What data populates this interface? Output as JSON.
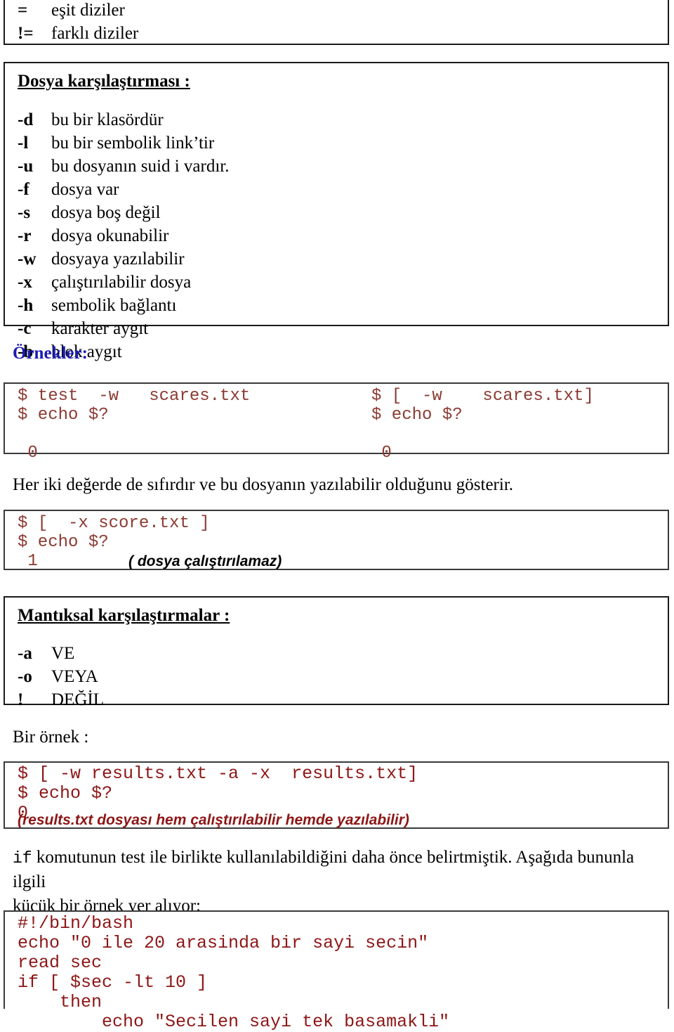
{
  "document": {
    "language": "tr",
    "accent_blue": "#1b1bb3",
    "code_color": "#8b3a32",
    "code_color_dark": "#8e1616"
  },
  "string_compare_box": {
    "rows": [
      {
        "key": "=",
        "value": "eşit diziler"
      },
      {
        "key": "!=",
        "value": "farklı diziler"
      }
    ]
  },
  "file_compare_box": {
    "title": "Dosya karşılaştırması :",
    "rows": [
      {
        "key": "-d",
        "value": "bu bir klasördür"
      },
      {
        "key": "-l",
        "value": "bu bir sembolik link’tir"
      },
      {
        "key": "-u",
        "value": "bu dosyanın suid i vardır."
      },
      {
        "key": "-f",
        "value": "dosya var"
      },
      {
        "key": "-s",
        "value": "dosya boş değil"
      },
      {
        "key": "-r",
        "value": "dosya okunabilir"
      },
      {
        "key": "-w",
        "value": "dosyaya yazılabilir"
      },
      {
        "key": "-x",
        "value": "çalıştırılabilir dosya"
      },
      {
        "key": "-h",
        "value": "sembolik bağlantı"
      },
      {
        "key": "-c",
        "value": "karakter aygıt"
      },
      {
        "key": "-b",
        "value": "blok aygıt"
      }
    ]
  },
  "examples": {
    "heading": "Örnekler:",
    "code_left": "$ test  -w   scares.txt\n$ echo $?\n\n 0",
    "code_right": "$ [  -w    scares.txt]\n$ echo $?\n\n 0",
    "explanation": "Her iki değerde de sıfırdır ve bu dosyanın yazılabilir olduğunu gösterir."
  },
  "exec_example": {
    "code": "$ [  -x score.txt ]\n$ echo $?\n 1",
    "annotation": "( dosya çalıştırılamaz)"
  },
  "logical_box": {
    "title": "Mantıksal karşılaştırmalar :",
    "rows": [
      {
        "key": "-a",
        "value": "VE"
      },
      {
        "key": "-o",
        "value": "VEYA"
      },
      {
        "key": "!",
        "value": "DEĞİL"
      }
    ]
  },
  "example_intro": "Bir örnek :",
  "and_example": {
    "code": "$ [ -w results.txt -a -x  results.txt]\n$ echo $?\n0",
    "annotation": "(results.txt dosyası hem çalıştırılabilir hemde yazılabilir)"
  },
  "if_paragraph": {
    "mono_prefix": "if",
    "text": " komutunun test ile birlikte kullanılabildiğini daha önce belirtmiştik. Aşağıda bununla ilgili\nküçük bir örnek yer alıyor:"
  },
  "bash_script": {
    "code": "#!/bin/bash\necho \"0 ile 20 arasinda bir sayi secin\"\nread sec\nif [ $sec -lt 10 ]\n    then\n        echo \"Secilen sayi tek basamakli\""
  }
}
